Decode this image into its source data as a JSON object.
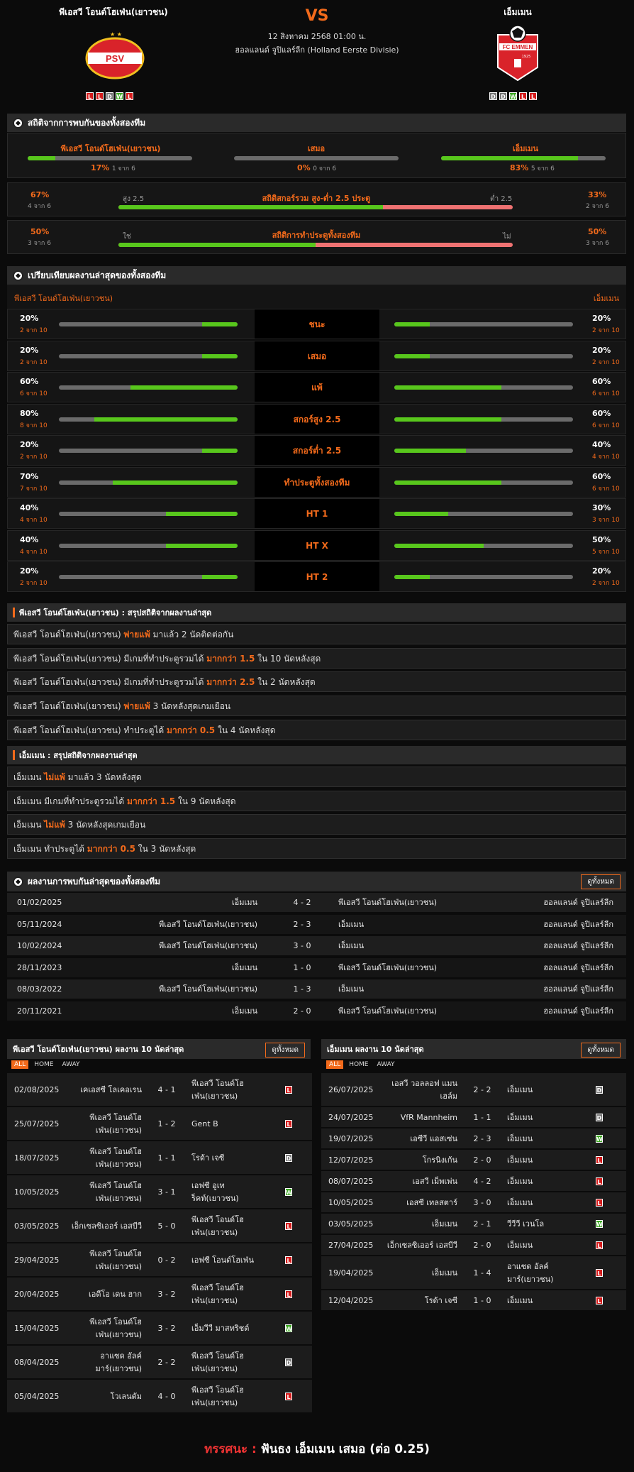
{
  "header": {
    "home": "พีเอสวี โอนด์โฮเฟ่น(เยาวชน)",
    "away": "เอ็มเมน",
    "vs": "VS",
    "date": "12 สิงหาคม 2568 01:00 น.",
    "league": "ฮอลแลนด์ จูปิแลร์ลีก (Holland Eerste Divisie)",
    "home_logo_text": "PSV",
    "away_logo_text": "FC EMMEN",
    "away_logo_year": "1925",
    "home_form": [
      "L",
      "L",
      "D",
      "W",
      "L"
    ],
    "away_form": [
      "D",
      "D",
      "W",
      "L",
      "L"
    ]
  },
  "h2h_stats": {
    "title": "สถิติจากการพบกันของทั้งสองทีม",
    "home": {
      "label": "พีเอสวี โอนด์โฮเฟ่น(เยาวชน)",
      "pct": "17%",
      "of": "1 จาก 6",
      "value": 0.17
    },
    "draw": {
      "label": "เสมอ",
      "pct": "0%",
      "of": "0 จาก 6",
      "value": 0
    },
    "away": {
      "label": "เอ็มเมน",
      "pct": "83%",
      "of": "5 จาก 6",
      "value": 0.83
    },
    "ou": {
      "title": "สถิติสกอร์รวม สูง-ต่ำ 2.5 ประตู",
      "left": "สูง 2.5",
      "right": "ต่ำ 2.5",
      "lp": "67%",
      "lo": "4 จาก 6",
      "rp": "33%",
      "ro": "2 จาก 6",
      "value": 0.67
    },
    "bts": {
      "title": "สถิติการทำประตูทั้งสองทีม",
      "left": "ใช่",
      "right": "ไม่",
      "lp": "50%",
      "lo": "3 จาก 6",
      "rp": "50%",
      "ro": "3 จาก 6",
      "value": 0.5
    }
  },
  "compare": {
    "title": "เปรียบเทียบผลงานล่าสุดของทั้งสองทีม",
    "home": "พีเอสวี โอนด์โฮเฟ่น(เยาวชน)",
    "away": "เอ็มเมน",
    "rows": [
      {
        "label": "ชนะ",
        "hp": "20%",
        "ho": "2 จาก 10",
        "hv": 0.2,
        "ap": "20%",
        "ao": "2 จาก 10",
        "av": 0.2
      },
      {
        "label": "เสมอ",
        "hp": "20%",
        "ho": "2 จาก 10",
        "hv": 0.2,
        "ap": "20%",
        "ao": "2 จาก 10",
        "av": 0.2
      },
      {
        "label": "แพ้",
        "hp": "60%",
        "ho": "6 จาก 10",
        "hv": 0.6,
        "ap": "60%",
        "ao": "6 จาก 10",
        "av": 0.6
      },
      {
        "label": "สกอร์สูง 2.5",
        "hp": "80%",
        "ho": "8 จาก 10",
        "hv": 0.8,
        "ap": "60%",
        "ao": "6 จาก 10",
        "av": 0.6
      },
      {
        "label": "สกอร์ต่ำ 2.5",
        "hp": "20%",
        "ho": "2 จาก 10",
        "hv": 0.2,
        "ap": "40%",
        "ao": "4 จาก 10",
        "av": 0.4
      },
      {
        "label": "ทำประตูทั้งสองทีม",
        "hp": "70%",
        "ho": "7 จาก 10",
        "hv": 0.7,
        "ap": "60%",
        "ao": "6 จาก 10",
        "av": 0.6
      },
      {
        "label": "HT 1",
        "hp": "40%",
        "ho": "4 จาก 10",
        "hv": 0.4,
        "ap": "30%",
        "ao": "3 จาก 10",
        "av": 0.3
      },
      {
        "label": "HT X",
        "hp": "40%",
        "ho": "4 จาก 10",
        "hv": 0.4,
        "ap": "50%",
        "ao": "5 จาก 10",
        "av": 0.5
      },
      {
        "label": "HT 2",
        "hp": "20%",
        "ho": "2 จาก 10",
        "hv": 0.2,
        "ap": "20%",
        "ao": "2 จาก 10",
        "av": 0.2
      }
    ]
  },
  "home_summary": {
    "title": "พีเอสวี โอนด์โฮเฟ่น(เยาวชน) : สรุปสถิติจากผลงานล่าสุด",
    "rows": [
      [
        "พีเอสวี โอนด์โฮเฟ่น(เยาวชน) ",
        "พ่ายแพ้",
        " มาแล้ว 2 นัดติดต่อกัน"
      ],
      [
        "พีเอสวี โอนด์โฮเฟ่น(เยาวชน) มีเกมที่ทำประตูรวมได้ ",
        "มากกว่า 1.5",
        " ใน 10 นัดหลังสุด"
      ],
      [
        "พีเอสวี โอนด์โฮเฟ่น(เยาวชน) มีเกมที่ทำประตูรวมได้ ",
        "มากกว่า 2.5",
        " ใน 2 นัดหลังสุด"
      ],
      [
        "พีเอสวี โอนด์โฮเฟ่น(เยาวชน) ",
        "พ่ายแพ้",
        " 3 นัดหลังสุดเกมเยือน"
      ],
      [
        "พีเอสวี โอนด์โฮเฟ่น(เยาวชน) ทำประตูได้ ",
        "มากกว่า 0.5",
        " ใน 4 นัดหลังสุด"
      ]
    ]
  },
  "away_summary": {
    "title": "เอ็มเมน : สรุปสถิติจากผลงานล่าสุด",
    "rows": [
      [
        "เอ็มเมน ",
        "ไม่แพ้",
        " มาแล้ว 3 นัดหลังสุด"
      ],
      [
        "เอ็มเมน มีเกมที่ทำประตูรวมได้ ",
        "มากกว่า 1.5",
        " ใน 9 นัดหลังสุด"
      ],
      [
        "เอ็มเมน ",
        "ไม่แพ้",
        " 3 นัดหลังสุดเกมเยือน"
      ],
      [
        "เอ็มเมน ทำประตูได้ ",
        "มากกว่า 0.5",
        " ใน 3 นัดหลังสุด"
      ]
    ]
  },
  "h2h_results": {
    "title": "ผลงานการพบกันล่าสุดของทั้งสองทีม",
    "view_all": "ดูทั้งหมด",
    "rows": [
      [
        "01/02/2025",
        "เอ็มเมน",
        "4 - 2",
        "พีเอสวี โอนด์โฮเฟ่น(เยาวชน)",
        "ฮอลแลนด์ จูปิแลร์ลีก"
      ],
      [
        "05/11/2024",
        "พีเอสวี โอนด์โฮเฟ่น(เยาวชน)",
        "2 - 3",
        "เอ็มเมน",
        "ฮอลแลนด์ จูปิแลร์ลีก"
      ],
      [
        "10/02/2024",
        "พีเอสวี โอนด์โฮเฟ่น(เยาวชน)",
        "3 - 0",
        "เอ็มเมน",
        "ฮอลแลนด์ จูปิแลร์ลีก"
      ],
      [
        "28/11/2023",
        "เอ็มเมน",
        "1 - 0",
        "พีเอสวี โอนด์โฮเฟ่น(เยาวชน)",
        "ฮอลแลนด์ จูปิแลร์ลีก"
      ],
      [
        "08/03/2022",
        "พีเอสวี โอนด์โฮเฟ่น(เยาวชน)",
        "1 - 3",
        "เอ็มเมน",
        "ฮอลแลนด์ จูปิแลร์ลีก"
      ],
      [
        "20/11/2021",
        "เอ็มเมน",
        "2 - 0",
        "พีเอสวี โอนด์โฮเฟ่น(เยาวชน)",
        "ฮอลแลนด์ จูปิแลร์ลีก"
      ]
    ]
  },
  "home_last10": {
    "title": "พีเอสวี โอนด์โฮเฟ่น(เยาวชน) ผลงาน 10 นัดล่าสุด",
    "view_all": "ดูทั้งหมด",
    "tabs": [
      "ALL",
      "HOME",
      "AWAY"
    ],
    "rows": [
      [
        "02/08/2025",
        "เคเอสซี โลเคอเรน",
        "4 - 1",
        "พีเอสวี โอนด์โฮเฟ่น(เยาวชน)",
        "L"
      ],
      [
        "25/07/2025",
        "พีเอสวี โอนด์โฮเฟ่น(เยาวชน)",
        "1 - 2",
        "Gent B",
        "L"
      ],
      [
        "18/07/2025",
        "พีเอสวี โอนด์โฮเฟ่น(เยาวชน)",
        "1 - 1",
        "โรด้า เจซี",
        "D"
      ],
      [
        "10/05/2025",
        "พีเอสวี โอนด์โฮเฟ่น(เยาวชน)",
        "3 - 1",
        "เอฟซี อูเทร็คท์(เยาวชน)",
        "W"
      ],
      [
        "03/05/2025",
        "เอ็กเซลซิเออร์ เอสบีวี",
        "5 - 0",
        "พีเอสวี โอนด์โฮเฟ่น(เยาวชน)",
        "L"
      ],
      [
        "29/04/2025",
        "พีเอสวี โอนด์โฮเฟ่น(เยาวชน)",
        "0 - 2",
        "เอฟซี โอนด์โฮเฟ่น",
        "L"
      ],
      [
        "20/04/2025",
        "เอดีโอ เดน ฮาก",
        "3 - 2",
        "พีเอสวี โอนด์โฮเฟ่น(เยาวชน)",
        "L"
      ],
      [
        "15/04/2025",
        "พีเอสวี โอนด์โฮเฟ่น(เยาวชน)",
        "3 - 2",
        "เอ็มวีวี มาสทริชต์",
        "W"
      ],
      [
        "08/04/2025",
        "อาแซด อัลค์มาร์(เยาวชน)",
        "2 - 2",
        "พีเอสวี โอนด์โฮเฟ่น(เยาวชน)",
        "D"
      ],
      [
        "05/04/2025",
        "โวเลนดัม",
        "4 - 0",
        "พีเอสวี โอนด์โฮเฟ่น(เยาวชน)",
        "L"
      ]
    ]
  },
  "away_last10": {
    "title": "เอ็มเมน ผลงาน 10 นัดล่าสุด",
    "view_all": "ดูทั้งหมด",
    "tabs": [
      "ALL",
      "HOME",
      "AWAY"
    ],
    "rows": [
      [
        "26/07/2025",
        "เอสวี วอลลอฟ แมนเฮล์ม",
        "2 - 2",
        "เอ็มเมน",
        "D"
      ],
      [
        "24/07/2025",
        "VfR Mannheim",
        "1 - 1",
        "เอ็มเมน",
        "D"
      ],
      [
        "19/07/2025",
        "เอซีวี แอสเซ่น",
        "2 - 3",
        "เอ็มเมน",
        "W"
      ],
      [
        "12/07/2025",
        "โกรนิงเก้น",
        "2 - 0",
        "เอ็มเมน",
        "L"
      ],
      [
        "08/07/2025",
        "เอสวี เม็พเพ่น",
        "4 - 2",
        "เอ็มเมน",
        "L"
      ],
      [
        "10/05/2025",
        "เอสซี เทลสตาร์",
        "3 - 0",
        "เอ็มเมน",
        "L"
      ],
      [
        "03/05/2025",
        "เอ็มเมน",
        "2 - 1",
        "วีวีวี เวนโล",
        "W"
      ],
      [
        "27/04/2025",
        "เอ็กเซลซิเออร์ เอสบีวี",
        "2 - 0",
        "เอ็มเมน",
        "L"
      ],
      [
        "19/04/2025",
        "เอ็มเมน",
        "1 - 4",
        "อาแซด อัลค์มาร์(เยาวชน)",
        "L"
      ],
      [
        "12/04/2025",
        "โรด้า เจซี",
        "1 - 0",
        "เอ็มเมน",
        "L"
      ]
    ]
  },
  "verdict": {
    "label": "ทรรศนะ :",
    "text": "ฟันธง เอ็มเมน เสมอ (ต่อ 0.25)"
  }
}
